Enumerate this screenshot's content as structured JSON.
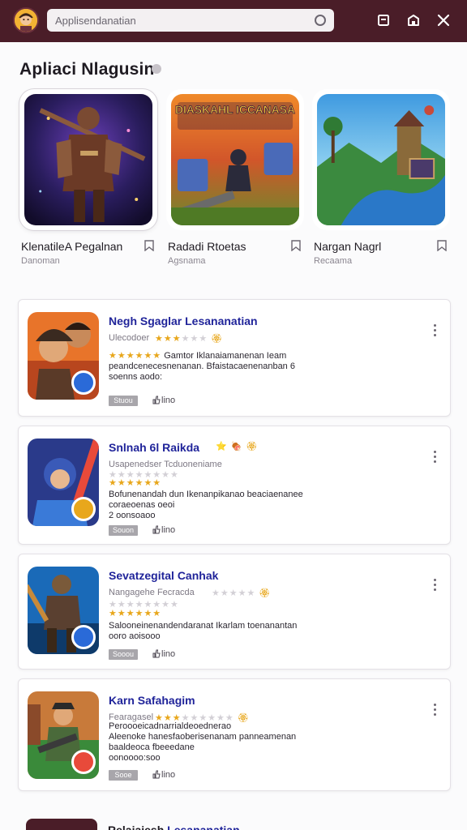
{
  "search": {
    "placeholder": "Applisendanatian"
  },
  "section": {
    "title": "Apliaci Nlagusin"
  },
  "featured": [
    {
      "name": "KlenatileA Pegalnan",
      "sub": "Danoman",
      "art_title": "DIASKAHL ICCANASA"
    },
    {
      "name": "Radadi Rtoetas",
      "sub": "Agsnama"
    },
    {
      "name": "Nargan Nagrl",
      "sub": "Recaama"
    }
  ],
  "cards": [
    {
      "title": "Negh Sgaglar Lesananatian",
      "sub": "Ulecodoer",
      "stars_on": 3,
      "stars_off": 3,
      "row2_text": "Gamtor Iklanaiamanenan Ieam",
      "desc": [
        "peandcenecesnenanan. Bfaistacaenenanban 6",
        "soenns aodo:"
      ],
      "tag": "Stuou",
      "likes": "lino"
    },
    {
      "title": "Snlnah 6l Raikda",
      "sub": "Usapenedser Tcduoneniame",
      "stars_on": 0,
      "stars_off": 8,
      "row2_text": "",
      "desc": [
        "Bofunenandah dun Ikenanpikanao beaciaenanee",
        "coraeoenas oeoi",
        "2 oonsoaoo"
      ],
      "tag": "Souon",
      "likes": "lino"
    },
    {
      "title": "Sevatzegital Canhak",
      "sub": "Nangagehe Fecracda",
      "stars_on": 0,
      "stars_off": 8,
      "row2_text": "",
      "desc": [
        "Salooneinenandendaranat Ikarlam toenanantan",
        "ooro aoisooo"
      ],
      "tag": "Sooou",
      "likes": "lino"
    },
    {
      "title": "Karn Safahagim",
      "sub": "Fearagasel",
      "stars_on": 3,
      "stars_off": 3,
      "row2_text": "Peroooeicadnarrialdeoednerao",
      "desc": [
        "Aleenoke hanesfaoberisenanam panneamenan",
        "baaldeoca fbeeedane",
        "oonoooo:soo"
      ],
      "tag": "Sooe",
      "likes": "lino"
    }
  ],
  "bottom": {
    "title_a": "Relaiaiesh",
    "title_b": "Lesananatian"
  },
  "colors": {
    "topbar": "#4a1d28",
    "title_blue": "#20249a",
    "star": "#e8a71c"
  }
}
